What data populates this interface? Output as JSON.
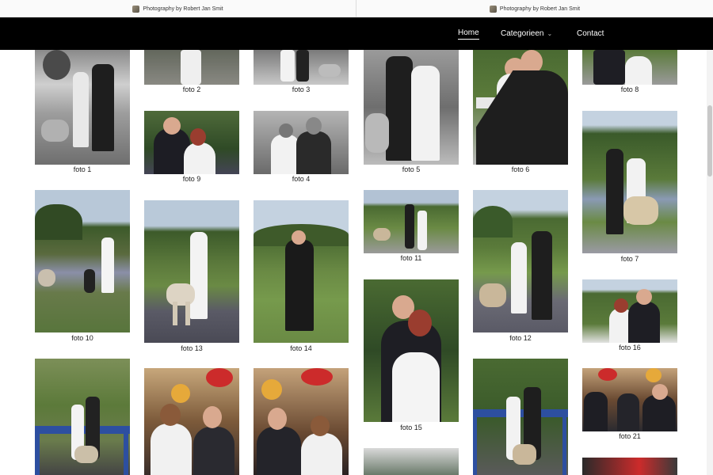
{
  "window_titles": [
    "Photography by Robert Jan Smit",
    "Photography by Robert Jan Smit"
  ],
  "nav": {
    "home": "Home",
    "categories": "Categorieen",
    "contact": "Contact"
  },
  "photos": [
    {
      "id": "p1",
      "caption": "foto 1"
    },
    {
      "id": "p2",
      "caption": "foto 2"
    },
    {
      "id": "p3",
      "caption": "foto 3"
    },
    {
      "id": "p9",
      "caption": "foto 9"
    },
    {
      "id": "p4",
      "caption": "foto 4"
    },
    {
      "id": "p5",
      "caption": "foto 5"
    },
    {
      "id": "p6",
      "caption": "foto 6"
    },
    {
      "id": "p8",
      "caption": "foto 8"
    },
    {
      "id": "p7",
      "caption": "foto 7"
    },
    {
      "id": "p10",
      "caption": "foto 10"
    },
    {
      "id": "p13",
      "caption": "foto 13"
    },
    {
      "id": "p14",
      "caption": "foto 14"
    },
    {
      "id": "p11",
      "caption": "foto 11"
    },
    {
      "id": "p12",
      "caption": "foto 12"
    },
    {
      "id": "p15",
      "caption": "foto 15"
    },
    {
      "id": "p16",
      "caption": "foto 16"
    },
    {
      "id": "p21",
      "caption": "foto 21"
    }
  ],
  "icons": {
    "chevron": "chevron-down-icon"
  }
}
